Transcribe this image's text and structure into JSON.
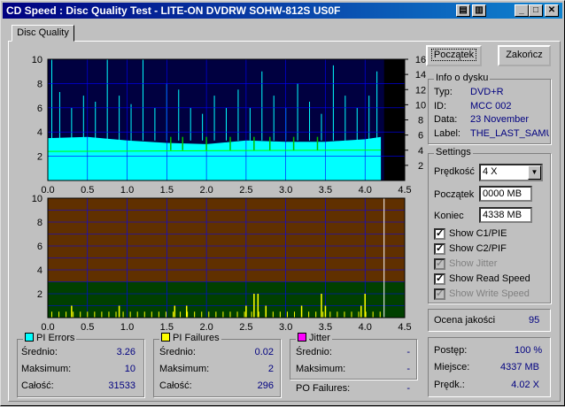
{
  "window": {
    "title": "CD Speed : Disc Quality Test - LITE-ON DVDRW SOHW-812S  US0F",
    "tab": "Disc Quality"
  },
  "buttons": {
    "start": "Początek",
    "end": "Zakończ"
  },
  "disc_info": {
    "label": "Info o dysku",
    "rows": [
      {
        "k": "Typ:",
        "v": "DVD+R"
      },
      {
        "k": "ID:",
        "v": "MCC 002"
      },
      {
        "k": "Data:",
        "v": "23 November"
      },
      {
        "k": "Label:",
        "v": "THE_LAST_SAMU"
      }
    ]
  },
  "settings": {
    "label": "Settings",
    "speed_label": "Prędkość",
    "speed_value": "4 X",
    "start_label": "Początek",
    "start_value": "0000 MB",
    "end_label": "Koniec",
    "end_value": "4338 MB",
    "checks": [
      {
        "label": "Show C1/PIE",
        "checked": true,
        "enabled": true
      },
      {
        "label": "Show C2/PIF",
        "checked": true,
        "enabled": true
      },
      {
        "label": "Show Jitter",
        "checked": true,
        "enabled": false
      },
      {
        "label": "Show Read Speed",
        "checked": true,
        "enabled": true
      },
      {
        "label": "Show Write Speed",
        "checked": true,
        "enabled": false
      }
    ]
  },
  "quality": {
    "label": "Ocena jakości",
    "value": "95"
  },
  "progress": {
    "rows": [
      {
        "k": "Postęp:",
        "v": "100 %"
      },
      {
        "k": "Miejsce:",
        "v": "4337 MB"
      },
      {
        "k": "Prędk.:",
        "v": "4.02 X"
      }
    ]
  },
  "pi_errors": {
    "label": "PI Errors",
    "color": "#00ffff",
    "rows": [
      {
        "k": "Średnio:",
        "v": "3.26"
      },
      {
        "k": "Maksimum:",
        "v": "10"
      },
      {
        "k": "Całość:",
        "v": "31533"
      }
    ]
  },
  "pi_failures": {
    "label": "PI Failures",
    "color": "#ffff00",
    "rows": [
      {
        "k": "Średnio:",
        "v": "0.02"
      },
      {
        "k": "Maksimum:",
        "v": "2"
      },
      {
        "k": "Całość:",
        "v": "296"
      }
    ]
  },
  "jitter": {
    "label": "Jitter",
    "color": "#ff00ff",
    "rows": [
      {
        "k": "Średnio:",
        "v": "-"
      },
      {
        "k": "Maksimum:",
        "v": "-"
      }
    ]
  },
  "po_failures": {
    "k": "PO Failures:",
    "v": "-"
  },
  "chart_data": [
    {
      "type": "area",
      "x_ticks": [
        "0.0",
        "0.5",
        "1.0",
        "1.5",
        "2.0",
        "2.5",
        "3.0",
        "3.5",
        "4.0",
        "4.5"
      ],
      "y_ticks": [
        "2",
        "4",
        "6",
        "8",
        "10"
      ],
      "y2_ticks": [
        "2",
        "4",
        "6",
        "8",
        "10",
        "12",
        "14",
        "16"
      ],
      "xlim": [
        0,
        4.5
      ],
      "ylim": [
        0,
        10
      ],
      "y2lim": [
        0,
        16
      ],
      "grid": true,
      "series": [
        {
          "color": "#00ffff",
          "x": [
            0.0,
            0.5,
            1.0,
            1.5,
            2.0,
            2.5,
            3.0,
            3.5,
            4.0,
            4.2
          ],
          "y": [
            3.5,
            3.6,
            3.3,
            3.1,
            3.0,
            3.3,
            3.2,
            3.2,
            3.4,
            3.6
          ],
          "max": 10
        },
        {
          "color": "#00ff00",
          "x": [
            0.0,
            4.2
          ],
          "y": [
            4.0,
            4.1
          ]
        }
      ],
      "background": "#000040"
    },
    {
      "type": "bar",
      "x_ticks": [
        "0.0",
        "0.5",
        "1.0",
        "1.5",
        "2.0",
        "2.5",
        "3.0",
        "3.5",
        "4.0",
        "4.5"
      ],
      "y_ticks": [
        "2",
        "4",
        "6",
        "8",
        "10"
      ],
      "xlim": [
        0,
        4.5
      ],
      "ylim": [
        0,
        10
      ],
      "grid": true,
      "bands": [
        {
          "from": 0,
          "to": 3,
          "color": "#004000"
        },
        {
          "from": 3,
          "to": 10,
          "color": "#603000"
        }
      ],
      "series": [
        {
          "color": "#ffff00",
          "x": [
            0.3,
            0.9,
            1.6,
            1.75,
            2.5,
            2.6,
            2.65,
            2.75,
            3.2,
            3.45,
            3.5,
            3.95,
            4.0
          ],
          "y": [
            1,
            1,
            1,
            1,
            1,
            2,
            2,
            1,
            1,
            2,
            1,
            1,
            2
          ]
        }
      ]
    }
  ]
}
